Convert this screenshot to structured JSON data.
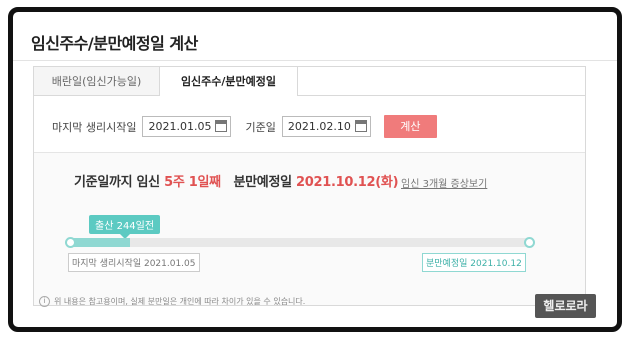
{
  "page": {
    "title": "임신주수/분만예정일 계산"
  },
  "tabs": [
    {
      "label": "배란일(임신가능일)"
    },
    {
      "label": "임신주수/분만예정일"
    }
  ],
  "form": {
    "last_period_label": "마지막 생리시작일",
    "last_period_value": "2021.01.05",
    "standard_label": "기준일",
    "standard_value": "2021.02.10",
    "calc_button": "계산"
  },
  "result": {
    "prefix": "기준일까지 임신",
    "weeks": "5주 1일째",
    "due_label": "분만예정일",
    "due_value": "2021.10.12(화)",
    "detail_link": "임신 3개월 증상보기",
    "bubble": "출산 244일전",
    "start_tag": "마지막 생리시작일 2021.01.05",
    "end_tag": "분만예정일 2021.10.12",
    "progress_fraction": 0.13
  },
  "footnote": "위 내용은 참고용이며, 실제 분만일은 개인에 따라 차이가 있을 수 있습니다.",
  "watermark": "헬로로라",
  "colors": {
    "accent_red": "#e05252",
    "calc_button": "#f07b7b",
    "progress_teal": "#8fd8d2"
  }
}
